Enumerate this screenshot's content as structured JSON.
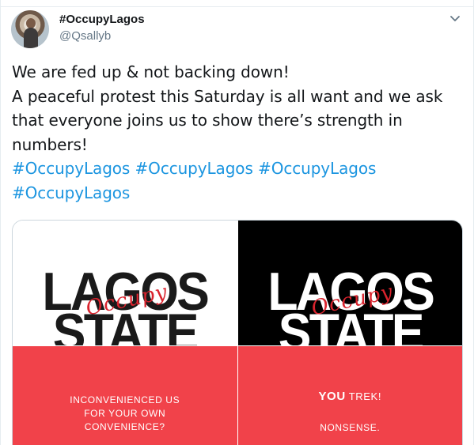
{
  "user": {
    "display_name": "#OccupyLagos",
    "handle": "@Qsallyb"
  },
  "tweet": {
    "line1": "We are fed up & not backing down!",
    "line2": "A peaceful protest this Saturday is all want and we ask",
    "line3": "that everyone joins us to show there’s strength in",
    "line4": "numbers!",
    "hashtags": [
      "#OccupyLagos",
      "#OccupyLagos",
      "#OccupyLagos",
      "#OccupyLagos"
    ]
  },
  "media": {
    "left": {
      "word_top": "LAGOS",
      "word_bottom": "STATE",
      "script_word": "Occupy",
      "caption_lines": [
        "INCONVENIENCED US",
        "FOR YOUR OWN",
        "CONVENIENCE?"
      ]
    },
    "right": {
      "word_top": "LAGOS",
      "word_bottom": "STATE",
      "script_word": "Occupy",
      "caption_you": "YOU",
      "caption_trek": " TREK!",
      "caption_nonsense": "NONSENSE."
    }
  },
  "colors": {
    "hashtag": "#1b95e0",
    "accent_red": "#f1424a",
    "text": "#14171a",
    "muted": "#657786"
  },
  "icons": {
    "caret": "chevron-down-icon"
  }
}
